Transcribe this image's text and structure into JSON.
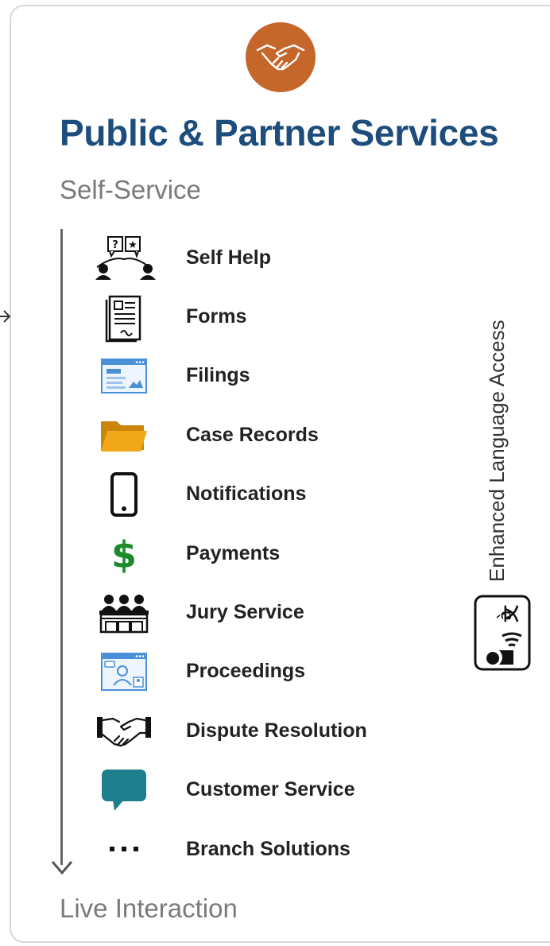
{
  "header": {
    "logo_icon": "handshake-icon",
    "title": "Public & Partner Services",
    "subtitle": "Self-Service"
  },
  "services": [
    {
      "label": "Self Help",
      "icon": "self-help-icon"
    },
    {
      "label": "Forms",
      "icon": "form-document-icon"
    },
    {
      "label": "Filings",
      "icon": "browser-window-icon"
    },
    {
      "label": "Case Records",
      "icon": "folder-icon"
    },
    {
      "label": "Notifications",
      "icon": "mobile-phone-icon"
    },
    {
      "label": "Payments",
      "icon": "dollar-icon"
    },
    {
      "label": "Jury Service",
      "icon": "jury-box-icon"
    },
    {
      "label": "Proceedings",
      "icon": "video-conference-icon"
    },
    {
      "label": "Dispute Resolution",
      "icon": "handshake-icon"
    },
    {
      "label": "Customer Service",
      "icon": "speech-bubble-icon"
    },
    {
      "label": "Branch Solutions",
      "icon": "ellipsis-icon"
    }
  ],
  "footer": {
    "label": "Live Interaction"
  },
  "side": {
    "label": "Enhanced Language Access",
    "icon": "translation-speaker-icon"
  },
  "colors": {
    "title": "#1d4d7c",
    "logo_circle": "#c5662a",
    "folder": "#e8a317",
    "dollar": "#1e8a2e",
    "speech_bubble": "#1f7f8c",
    "browser": "#4a90d9",
    "muted_text": "#7a7a7a"
  }
}
